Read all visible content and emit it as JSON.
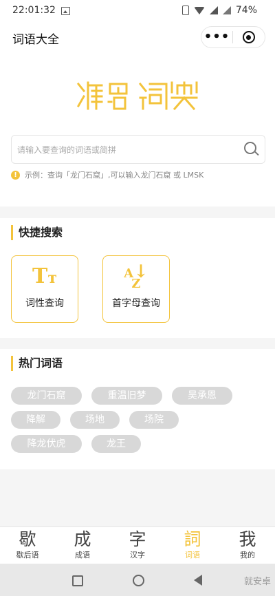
{
  "status": {
    "time": "22:01:32",
    "battery": "74%"
  },
  "navbar": {
    "title": "词语大全",
    "more": "•••"
  },
  "logo": {
    "text": "汉语词典"
  },
  "search": {
    "placeholder": "请输入要查询的词语或简拼"
  },
  "hint": {
    "icon": "info-icon",
    "text": "示例：查询「龙门石窟」,可以输入龙门石窟 或 LMSK"
  },
  "quick": {
    "title": "快捷搜索",
    "buttons": [
      {
        "icon": "Tт",
        "label": "词性查询"
      },
      {
        "icon": "A↓Z",
        "label": "首字母查询"
      }
    ]
  },
  "hot": {
    "title": "热门词语",
    "tags": [
      "龙门石窟",
      "重温旧梦",
      "吴承恩",
      "降解",
      "场地",
      "场院",
      "降龙伏虎",
      "龙王"
    ]
  },
  "tabbar": {
    "items": [
      {
        "icon": "歇",
        "label": "歇后语"
      },
      {
        "icon": "成",
        "label": "成语"
      },
      {
        "icon": "字",
        "label": "汉字"
      },
      {
        "icon": "詞",
        "label": "词语"
      },
      {
        "icon": "我",
        "label": "我的"
      }
    ],
    "active_color": "#f3c33b"
  },
  "watermark": "就安卓",
  "colors": {
    "accent": "#f3c33b",
    "tag_bg": "#d8d8d8"
  }
}
